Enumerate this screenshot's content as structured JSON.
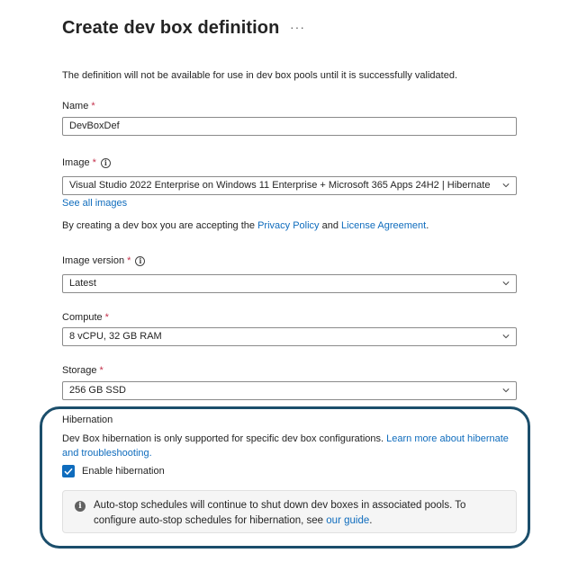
{
  "header": {
    "title": "Create dev box definition",
    "more_glyph": "···"
  },
  "intro": "The definition will not be available for use in dev box pools until it is successfully validated.",
  "name_field": {
    "label": "Name",
    "required_mark": "*",
    "value": "DevBoxDef"
  },
  "image_field": {
    "label": "Image",
    "required_mark": "*",
    "value": "Visual Studio 2022 Enterprise on Windows 11 Enterprise + Microsoft 365 Apps 24H2 | Hibernate ...",
    "see_all": "See all images"
  },
  "agreement": {
    "prefix": "By creating a dev box you are accepting the ",
    "privacy_link": "Privacy Policy",
    "middle": " and ",
    "license_link": "License Agreement",
    "suffix": "."
  },
  "image_version_field": {
    "label": "Image version",
    "required_mark": "*",
    "value": "Latest"
  },
  "compute_field": {
    "label": "Compute",
    "required_mark": "*",
    "value": "8 vCPU, 32 GB RAM"
  },
  "storage_field": {
    "label": "Storage",
    "required_mark": "*",
    "value": "256 GB SSD"
  },
  "hibernation": {
    "heading": "Hibernation",
    "desc_prefix": "Dev Box hibernation is only supported for specific dev box configurations. ",
    "learn_more_link": "Learn more about hibernate and troubleshooting.",
    "checkbox_label": "Enable hibernation",
    "checkbox_checked": true,
    "banner_prefix": "Auto-stop schedules will continue to shut down dev boxes in associated pools. To configure auto-stop schedules for hibernation, see ",
    "banner_link": "our guide",
    "banner_suffix": "."
  },
  "colors": {
    "accent": "#0f6cbd",
    "required": "#c4314b",
    "highlight_border": "#1b4e6b"
  }
}
